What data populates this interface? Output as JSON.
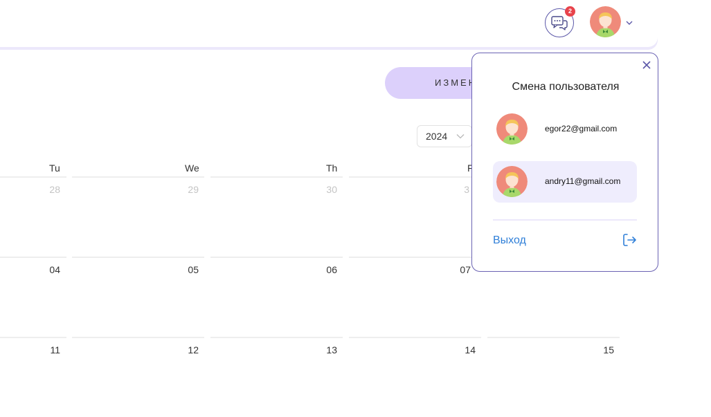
{
  "header": {
    "chat_badge_count": "2",
    "chat_icon": "chat-bubbles-icon",
    "profile_chevron_icon": "chevron-down-icon"
  },
  "toolbar": {
    "action_label": "ИЗМЕН"
  },
  "calendar": {
    "year": "2024",
    "day_headers": [
      "Tu",
      "We",
      "Th",
      "F"
    ],
    "rows": [
      [
        "28",
        "29",
        "30",
        "3"
      ],
      [
        "04",
        "05",
        "06",
        "07"
      ],
      [
        "11",
        "12",
        "13",
        "14",
        "15"
      ]
    ]
  },
  "account_menu": {
    "title": "Смена пользователя",
    "users": [
      {
        "email": "egor22@gmail.com",
        "active": false
      },
      {
        "email": "andry11@gmail.com",
        "active": true
      }
    ],
    "logout_label": "Выход",
    "close_icon": "close-icon",
    "logout_icon": "logout-icon"
  },
  "colors": {
    "accent": "#6a62b3",
    "badge": "#e8434b",
    "button_bg": "#dcd0fb",
    "active_row": "#efedfd",
    "link": "#2f7fd8"
  }
}
